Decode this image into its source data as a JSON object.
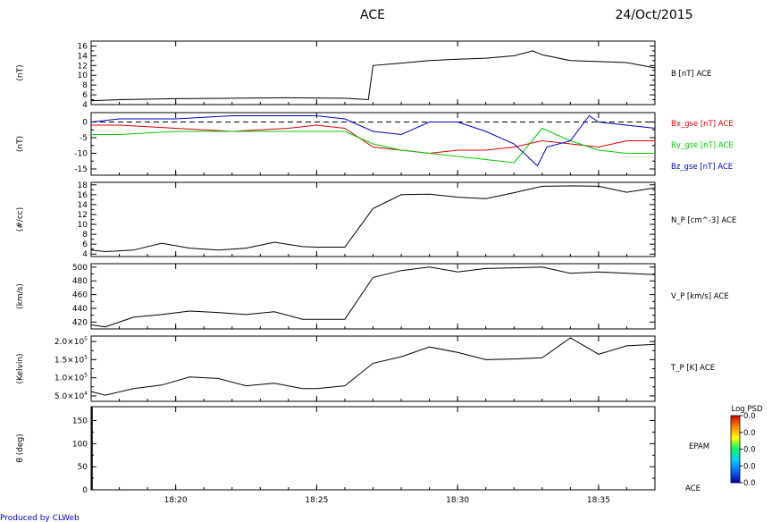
{
  "header": {
    "instrument": "ACE",
    "date": "24/Oct/2015"
  },
  "footer": {
    "credit": "Produced by CLWeb"
  },
  "colors": {
    "black": "#000000",
    "red": "#dd0000",
    "green": "#00cc00",
    "blue": "#0000cc",
    "credit": "#0000cc"
  },
  "chart_data": [
    {
      "type": "line",
      "ylabel": "(nT)",
      "ylim": [
        4,
        17
      ],
      "yticks": [
        4,
        6,
        8,
        10,
        12,
        14,
        16
      ],
      "series": [
        {
          "name": "B [nT] ACE",
          "color": "#000000",
          "x": [
            "18:17:00",
            "18:18:00",
            "18:20:00",
            "18:22:00",
            "18:24:00",
            "18:26:00",
            "18:26:50",
            "18:27:00",
            "18:28:00",
            "18:29:00",
            "18:30:00",
            "18:31:00",
            "18:32:00",
            "18:32:40",
            "18:33:00",
            "18:34:00",
            "18:35:00",
            "18:36:00",
            "18:37:00"
          ],
          "values": [
            4.8,
            5.0,
            5.2,
            5.3,
            5.4,
            5.3,
            5.0,
            12.0,
            12.5,
            13.0,
            13.3,
            13.5,
            14.0,
            15.0,
            14.2,
            13.0,
            12.8,
            12.6,
            11.5
          ]
        }
      ]
    },
    {
      "type": "line",
      "ylabel": "(nT)",
      "ylim": [
        -17,
        3
      ],
      "yticks": [
        -15,
        -10,
        -5,
        0
      ],
      "zero_line": true,
      "series": [
        {
          "name": "Bx_gse [nT] ACE",
          "color": "#dd0000",
          "x": [
            "18:17:00",
            "18:18:00",
            "18:20:00",
            "18:22:00",
            "18:24:00",
            "18:25:00",
            "18:26:00",
            "18:27:00",
            "18:28:00",
            "18:29:00",
            "18:30:00",
            "18:31:00",
            "18:32:00",
            "18:33:00",
            "18:34:00",
            "18:35:00",
            "18:36:00",
            "18:37:00"
          ],
          "values": [
            -1,
            -1,
            -2,
            -3,
            -2,
            -1,
            -2,
            -8,
            -9,
            -10,
            -9,
            -9,
            -8,
            -6,
            -7,
            -8,
            -6,
            -6
          ]
        },
        {
          "name": "By_gse [nT] ACE",
          "color": "#00cc00",
          "x": [
            "18:17:00",
            "18:18:00",
            "18:20:00",
            "18:22:00",
            "18:24:00",
            "18:25:00",
            "18:26:00",
            "18:27:00",
            "18:28:00",
            "18:29:00",
            "18:30:00",
            "18:31:00",
            "18:32:00",
            "18:33:00",
            "18:34:00",
            "18:35:00",
            "18:36:00",
            "18:37:00"
          ],
          "values": [
            -4,
            -4,
            -3,
            -3,
            -3,
            -3,
            -3,
            -7,
            -9,
            -10,
            -11,
            -12,
            -13,
            -2,
            -6,
            -9,
            -10,
            -10
          ]
        },
        {
          "name": "Bz_gse [nT] ACE",
          "color": "#0000cc",
          "x": [
            "18:17:00",
            "18:18:00",
            "18:20:00",
            "18:22:00",
            "18:24:00",
            "18:25:00",
            "18:26:00",
            "18:27:00",
            "18:28:00",
            "18:29:00",
            "18:30:00",
            "18:31:00",
            "18:32:00",
            "18:32:50",
            "18:33:10",
            "18:34:00",
            "18:34:40",
            "18:35:00",
            "18:36:00",
            "18:37:00"
          ],
          "values": [
            0,
            1,
            1,
            2,
            2,
            2,
            1,
            -3,
            -4,
            0,
            0,
            -3,
            -7,
            -14,
            -8,
            -6,
            2,
            0,
            -1,
            -2
          ]
        }
      ]
    },
    {
      "type": "line",
      "ylabel": "(#/cc)",
      "ylim": [
        3.5,
        18.5
      ],
      "yticks": [
        4,
        6,
        8,
        10,
        12,
        14,
        16,
        18
      ],
      "series": [
        {
          "name": "N_P [cm^-3] ACE",
          "color": "#000000",
          "x": [
            "18:17:00",
            "18:17:30",
            "18:18:30",
            "18:19:30",
            "18:20:30",
            "18:21:30",
            "18:22:30",
            "18:23:30",
            "18:24:30",
            "18:25:00",
            "18:26:00",
            "18:27:00",
            "18:28:00",
            "18:29:00",
            "18:30:00",
            "18:31:00",
            "18:32:00",
            "18:33:00",
            "18:34:00",
            "18:35:00",
            "18:36:00",
            "18:37:00"
          ],
          "values": [
            4.8,
            4.5,
            4.8,
            6.2,
            5.2,
            4.8,
            5.2,
            6.4,
            5.5,
            5.4,
            5.4,
            13.2,
            16.0,
            16.1,
            15.5,
            15.2,
            16.4,
            17.7,
            17.8,
            17.7,
            16.5,
            17.4
          ]
        }
      ]
    },
    {
      "type": "line",
      "ylabel": "(km/s)",
      "ylim": [
        410,
        505
      ],
      "yticks": [
        420,
        440,
        460,
        480,
        500
      ],
      "series": [
        {
          "name": "V_P [km/s] ACE",
          "color": "#000000",
          "x": [
            "18:17:00",
            "18:17:30",
            "18:18:30",
            "18:19:30",
            "18:20:30",
            "18:21:30",
            "18:22:30",
            "18:23:30",
            "18:24:30",
            "18:25:00",
            "18:26:00",
            "18:27:00",
            "18:28:00",
            "18:29:00",
            "18:30:00",
            "18:31:00",
            "18:32:00",
            "18:33:00",
            "18:34:00",
            "18:35:00",
            "18:36:00",
            "18:37:00"
          ],
          "values": [
            416,
            413,
            427,
            431,
            436,
            434,
            431,
            435,
            424,
            424,
            424,
            485,
            495,
            500,
            493,
            498,
            499,
            500,
            491,
            493,
            491,
            489
          ]
        }
      ]
    },
    {
      "type": "line",
      "ylabel": "(Kelvin)",
      "ylim": [
        35000,
        215000
      ],
      "yticks": [
        50000,
        100000,
        150000,
        200000
      ],
      "ytick_labels": [
        [
          "5.0×10",
          "4"
        ],
        [
          "1.0×10",
          "5"
        ],
        [
          "1.5×10",
          "5"
        ],
        [
          "2.0×10",
          "5"
        ]
      ],
      "series": [
        {
          "name": "T_P [K] ACE",
          "color": "#000000",
          "x": [
            "18:17:00",
            "18:17:30",
            "18:18:30",
            "18:19:30",
            "18:20:30",
            "18:21:30",
            "18:22:30",
            "18:23:30",
            "18:24:30",
            "18:25:00",
            "18:26:00",
            "18:27:00",
            "18:28:00",
            "18:29:00",
            "18:30:00",
            "18:31:00",
            "18:32:00",
            "18:33:00",
            "18:34:00",
            "18:35:00",
            "18:36:00",
            "18:37:00"
          ],
          "values": [
            62000,
            52000,
            70000,
            80000,
            102000,
            98000,
            78000,
            85000,
            70000,
            70000,
            78000,
            140000,
            158000,
            185000,
            170000,
            150000,
            152000,
            155000,
            210000,
            165000,
            188000,
            192000
          ]
        }
      ]
    },
    {
      "type": "heatmap",
      "ylabel": "θ (deg)",
      "ylim": [
        0,
        180
      ],
      "yticks": [
        0,
        50,
        100,
        150
      ],
      "side_labels": [
        "EPAM",
        "ACE"
      ],
      "colorbar": {
        "title": "Log PSD",
        "tick_labels": [
          "0.0",
          "0.0",
          "0.0",
          "0.0",
          "0.0"
        ],
        "colors": [
          "#0000aa",
          "#0066ff",
          "#00ccff",
          "#00ff66",
          "#ffff00",
          "#ff8800",
          "#dd0000"
        ]
      },
      "values": []
    }
  ],
  "x_axis": {
    "range": [
      "18:17:00",
      "18:37:00"
    ],
    "major_ticks": [
      "18:20:00",
      "18:25:00",
      "18:30:00",
      "18:35:00"
    ],
    "major_labels": [
      "18:20",
      "18:25",
      "18:30",
      "18:35"
    ]
  }
}
